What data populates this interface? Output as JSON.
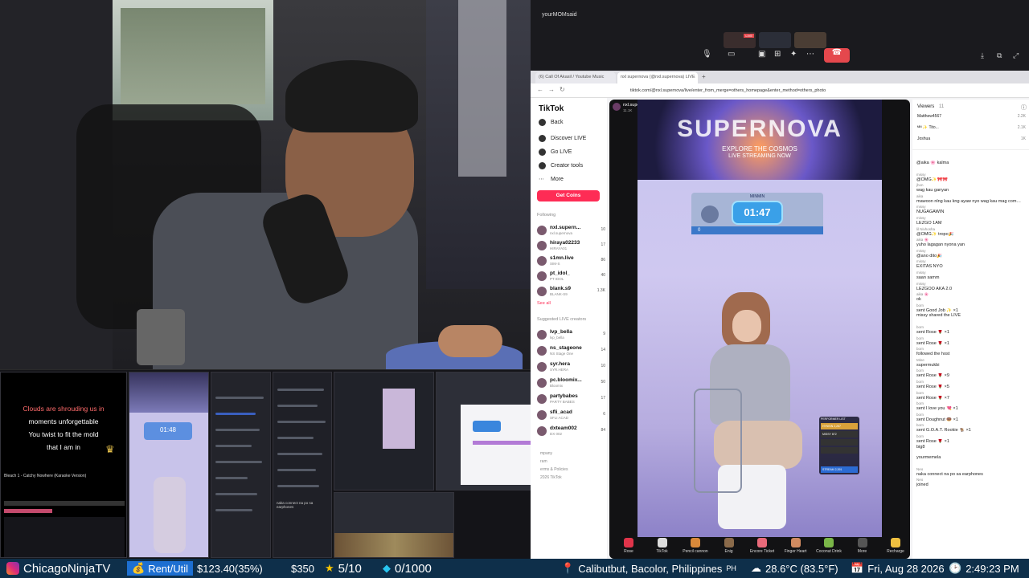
{
  "meeting": {
    "title": "yourMOMsaid",
    "live_badge": "LIVE"
  },
  "browser": {
    "tabs": [
      "(6) Call Of Akasil / Youtube Music",
      "nxl supernova (@nxl.supernova) LIVE",
      "+"
    ],
    "url": "tiktok.com/@nxl.supernova/live/enter_from_merge=others_homepage&enter_method=others_photo"
  },
  "tiktok_nav": {
    "logo": "TikTok",
    "back": "Back",
    "items": [
      "Discover LIVE",
      "Go LIVE",
      "Creator tools",
      "More"
    ],
    "get_coins": "Get Coins",
    "following_heading": "Following",
    "following": [
      {
        "name": "nxl.supern...",
        "sub": "nxl.supernova",
        "count": "10"
      },
      {
        "name": "hiraya02233",
        "sub": "HIRAYA01",
        "count": "17"
      },
      {
        "name": "s1mn.live",
        "sub": "SIM-S",
        "count": "86"
      },
      {
        "name": "pt_idol_",
        "sub": "PT IDOL",
        "count": "40"
      },
      {
        "name": "blank.s9",
        "sub": "BLANK-S9",
        "count": "1.3K"
      }
    ],
    "see_all": "See all",
    "suggested_heading": "Suggested LIVE creators",
    "suggested": [
      {
        "name": "lvp_bella",
        "sub": "lvp_bella",
        "count": "9"
      },
      {
        "name": "ns_stageone",
        "sub": "NS Stage One",
        "count": "14"
      },
      {
        "name": "syr.hera",
        "sub": "SYR.HERA",
        "count": "10"
      },
      {
        "name": "pc.bloomix...",
        "sub": "Bloomix",
        "count": "50"
      },
      {
        "name": "partybabes",
        "sub": "PARTY BABES",
        "count": "17"
      },
      {
        "name": "sfli_acad",
        "sub": "SFLI ACAD",
        "count": "6"
      },
      {
        "name": "dxteam002",
        "sub": "DX 002",
        "count": "84"
      }
    ],
    "footer": [
      "mpany",
      "ram",
      "erms & Policies",
      "2026 TikTok"
    ]
  },
  "stream": {
    "host": "nxl.supernova",
    "host_viewers": "11.1K",
    "banner_title": "SUPERNOVA",
    "banner_sub1": "EXPLORE THE COSMOS",
    "banner_sub2": "LIVE STREAMING NOW",
    "timer_name": "MINMIN",
    "timer": "01:47",
    "timer_score": "0",
    "performer_list_title": "PERFORMER LIST",
    "performers": [
      {
        "name": "HYNSIN",
        "score": "2,267"
      },
      {
        "name": "MISSY",
        "score": "872"
      },
      {
        "name": "",
        "score": ""
      },
      {
        "name": "",
        "score": ""
      },
      {
        "name": "STREAM",
        "score": "2,391"
      }
    ],
    "gifts": [
      "Rose",
      "TikTok",
      "Pencil cannon",
      "Enig",
      "Encore Ticket",
      "Finger Heart",
      "Coconut Drink",
      "More",
      "Recharge"
    ]
  },
  "viewers": {
    "label": "Viewers",
    "count": "11",
    "list": [
      {
        "name": "Matthew4567",
        "score": "2.2K"
      },
      {
        "name": "ᴹᴵᴺ ✨ Tito...",
        "score": "2.1K"
      },
      {
        "name": "Joshua",
        "score": "1K"
      }
    ]
  },
  "chat": [
    {
      "u": "",
      "m": "@aika 🌸 kalma"
    },
    {
      "u": "missy",
      "m": "@OMG✨🎀🎀"
    },
    {
      "u": "jhon",
      "m": "wag kau ganyan"
    },
    {
      "u": "aika",
      "m": "mawoon nlng kau kng ayaw nyo wag kau mag comment ng hndi maganda"
    },
    {
      "u": "missy",
      "m": "NUGAGAWIN"
    },
    {
      "u": "missy",
      "m": "LEZGO 1AM"
    },
    {
      "u": "lil Nivhosha",
      "m": "@OMG✨ tropo🎉"
    },
    {
      "u": "aika 🌸",
      "m": "yuho lagagan nyona yan"
    },
    {
      "u": "missy",
      "m": "@ano dito🎉"
    },
    {
      "u": "missy",
      "m": "EXITAS NYO"
    },
    {
      "u": "missy",
      "m": "saan samm"
    },
    {
      "u": "missy",
      "m": "LEZGOO AKA 2.0"
    },
    {
      "u": "aika 🌸",
      "m": "ok"
    },
    {
      "u": "born",
      "m": "sent Good Job ✨ ×1"
    },
    {
      "u": "",
      "m": "missy shared the LIVE"
    },
    {
      "u": "born",
      "m": "sent Rose 🌹 ×1"
    },
    {
      "u": "born",
      "m": "sent Rose 🌹 ×1"
    },
    {
      "u": "born",
      "m": "followed the host"
    },
    {
      "u": "Mine",
      "m": "supermukbi"
    },
    {
      "u": "born",
      "m": "sent Rose 🌹 ×9"
    },
    {
      "u": "born",
      "m": "sent Rose 🌹 ×5"
    },
    {
      "u": "born",
      "m": "sent Rose 🌹 ×7"
    },
    {
      "u": "born",
      "m": "sent I love you 💘 ×1"
    },
    {
      "u": "born",
      "m": "sent Doughnut 🍩 ×1"
    },
    {
      "u": "born",
      "m": "sent G.O.A.T. Rookie 🐐 ×1"
    },
    {
      "u": "born",
      "m": "sent Rose 🌹 ×1"
    },
    {
      "u": "",
      "m": "big8"
    },
    {
      "u": "",
      "m": "yourmemela"
    },
    {
      "u": "Neo",
      "m": "naka connect na po sa earphones"
    },
    {
      "u": "Neo",
      "m": "joined"
    }
  ],
  "left_strip": {
    "lyrics": [
      "Clouds are shrouding us in",
      "moments unforgettable",
      "You twist to fit the mold",
      "that I am in"
    ],
    "song_title": "Bleach 1 - Catchy Nowhere (Karaoke Version)",
    "overlay_timer": "01:48",
    "chat_snippet": "naka connect na po sa earphones"
  },
  "bottom_bar": {
    "channel": "ChicagoNinjaTV",
    "rent_label": "Rent/Util",
    "rent_value": "$123.40(35%)",
    "money": "$350",
    "stars": "5/10",
    "gems": "0/1000",
    "location": "Calibutbut, Bacolor, Philippines",
    "location_code": "PH",
    "weather": "28.6°C (83.5°F)",
    "date": "Fri, Aug 28 2026",
    "time": "2:49:23 PM"
  },
  "colors": {
    "bar_bg": "#0e2f4a",
    "tiktok_red": "#fe2c55",
    "timer_blue": "#3aa0e8",
    "end_call": "#e5484d"
  }
}
